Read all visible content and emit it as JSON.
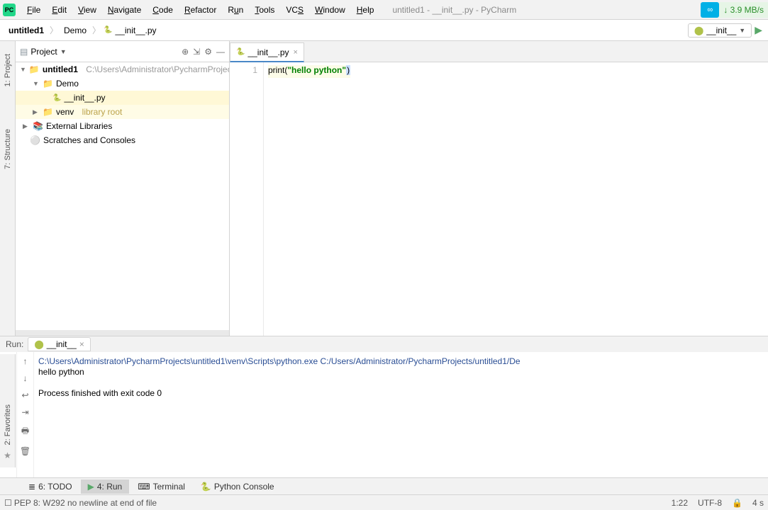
{
  "menu": {
    "items": [
      "File",
      "Edit",
      "View",
      "Navigate",
      "Code",
      "Refactor",
      "Run",
      "Tools",
      "VCS",
      "Window",
      "Help"
    ]
  },
  "window_title": "untitled1 - __init__.py - PyCharm",
  "net_speed": "↓ 3.9 MB/s",
  "breadcrumbs": [
    "untitled1",
    "Demo",
    "__init__.py"
  ],
  "run_config_label": "__init__",
  "project_panel": {
    "title": "Project",
    "root": {
      "name": "untitled1",
      "path": "C:\\Users\\Administrator\\PycharmProjects"
    },
    "demo": "Demo",
    "initpy": "__init__.py",
    "venv": "venv",
    "venv_note": "library root",
    "ext_libs": "External Libraries",
    "scratches": "Scratches and Consoles"
  },
  "editor": {
    "tab": "__init__.py",
    "line_no": "1",
    "code_print": "print",
    "code_open": "(",
    "code_str": "\"hello python\"",
    "code_close": ")"
  },
  "console": {
    "label": "Run:",
    "tab": "__init__",
    "cmd": "C:\\Users\\Administrator\\PycharmProjects\\untitled1\\venv\\Scripts\\python.exe C:/Users/Administrator/PycharmProjects/untitled1/De",
    "out": "hello python",
    "exit": "Process finished with exit code 0"
  },
  "bottom_tabs": {
    "todo": "6: TODO",
    "run": "4: Run",
    "terminal": "Terminal",
    "pyconsole": "Python Console"
  },
  "left_tools": {
    "project": "1: Project",
    "structure": "7: Structure"
  },
  "left_fav": "2: Favorites",
  "status": {
    "pep": "PEP 8: W292 no newline at end of file",
    "pos": "1:22",
    "enc": "UTF-8",
    "indent": "4 s"
  }
}
